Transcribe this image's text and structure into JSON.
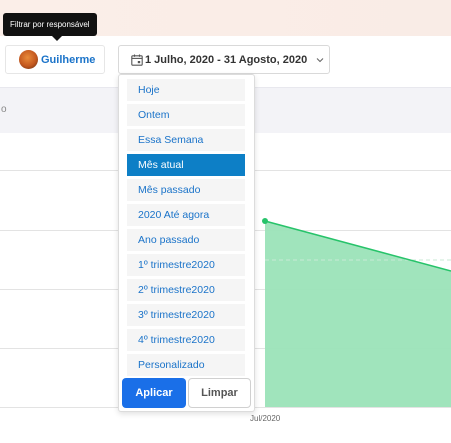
{
  "tooltip": {
    "text": "Filtrar por responsável"
  },
  "user_filter": {
    "name": "Guilherme"
  },
  "date_range": {
    "label": "1 Julho, 2020 - 31 Agosto, 2020"
  },
  "dropdown": {
    "options": [
      {
        "label": "Hoje",
        "active": false
      },
      {
        "label": "Ontem",
        "active": false
      },
      {
        "label": "Essa Semana",
        "active": false
      },
      {
        "label": "Mês atual",
        "active": true
      },
      {
        "label": "Mês passado",
        "active": false
      },
      {
        "label": "2020 Até agora",
        "active": false
      },
      {
        "label": "Ano passado",
        "active": false
      },
      {
        "label": "1º trimestre2020",
        "active": false
      },
      {
        "label": "2º trimestre2020",
        "active": false
      },
      {
        "label": "3º trimestre2020",
        "active": false
      },
      {
        "label": "4º trimestre2020",
        "active": false
      },
      {
        "label": "Personalizado",
        "active": false
      }
    ],
    "apply_label": "Aplicar",
    "clear_label": "Limpar"
  },
  "chart": {
    "y_label_partial": "o",
    "x_tick": "Jul/2020",
    "area_color": "#9be3b8",
    "line_color": "#27c36a"
  }
}
